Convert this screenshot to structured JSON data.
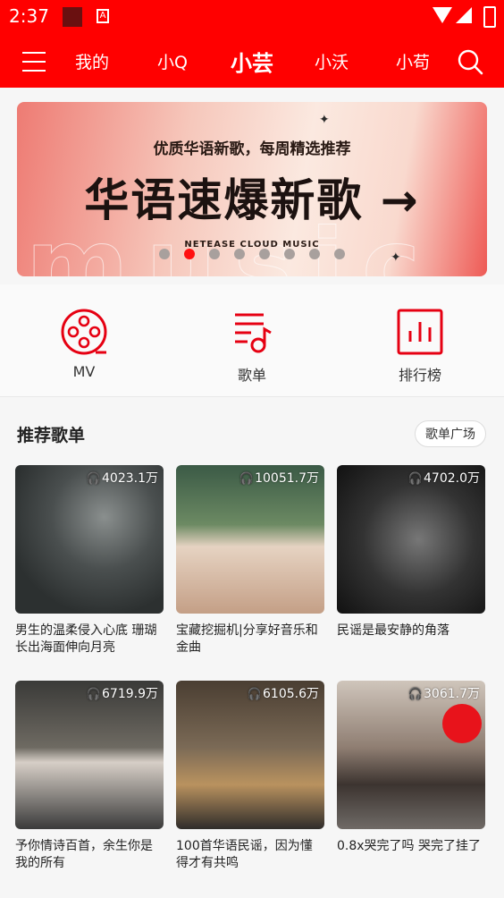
{
  "status": {
    "time": "2:37"
  },
  "topnav": {
    "tabs": [
      {
        "label": "我的",
        "active": false
      },
      {
        "label": "小Q",
        "active": false
      },
      {
        "label": "小芸",
        "active": true
      },
      {
        "label": "小沃",
        "active": false
      },
      {
        "label": "小苟",
        "active": false
      }
    ]
  },
  "banner": {
    "subtitle": "优质华语新歌，每周精选推荐",
    "headline": "华语速爆新歌 →",
    "brand": "NETEASE CLOUD MUSIC",
    "bg_word": "music",
    "dot_count": 8,
    "active_dot": 1
  },
  "quick": [
    {
      "label": "MV",
      "icon": "film-reel-icon"
    },
    {
      "label": "歌单",
      "icon": "playlist-icon"
    },
    {
      "label": "排行榜",
      "icon": "chart-icon"
    }
  ],
  "section": {
    "title": "推荐歌单",
    "more_label": "歌单广场"
  },
  "playlists": [
    {
      "count": "4023.1万",
      "title": "男生的温柔侵入心底 珊瑚长出海面伸向月亮"
    },
    {
      "count": "10051.7万",
      "title": "宝藏挖掘机|分享好音乐和金曲"
    },
    {
      "count": "4702.0万",
      "title": "民谣是最安静的角落"
    },
    {
      "count": "6719.9万",
      "title": "予你情诗百首，余生你是我的所有"
    },
    {
      "count": "6105.6万",
      "title": "100首华语民谣，因为懂得才有共鸣"
    },
    {
      "count": "3061.7万",
      "title": "0.8x哭完了吗 哭完了挂了"
    }
  ],
  "colors": {
    "brand": "#ff0000",
    "accent": "#e60012"
  }
}
